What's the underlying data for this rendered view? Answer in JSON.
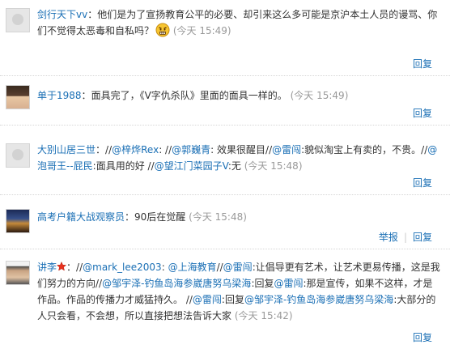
{
  "comments": [
    {
      "avatar": "default-avatar-icon",
      "name": "剑行天下vv",
      "sep": "：",
      "text": "他们是为了宣扬教育公平的必要、却引来这么多可能是京沪本土人员的谩骂、你们不觉得太恶毒和自私吗？",
      "emoji": "angry-emoji-icon",
      "time": "(今天 15:49)",
      "reply": "回复"
    },
    {
      "avatar": "user-photo-avatar",
      "name": "单于1988",
      "sep": "：",
      "text": "面具完了，《V字仇杀队》里面的面具一样的。",
      "time": "(今天 15:49)",
      "reply": "回复"
    },
    {
      "avatar": "default-avatar-icon",
      "name": "大别山居三世",
      "sep": "：",
      "segments": [
        {
          "t": "//",
          "link": false
        },
        {
          "t": "@梓烨Rex",
          "link": true
        },
        {
          "t": ": //",
          "link": false
        },
        {
          "t": "@郭巍青",
          "link": true
        },
        {
          "t": ": 效果很醒目//",
          "link": false
        },
        {
          "t": "@雷闯",
          "link": true
        },
        {
          "t": ":貌似淘宝上有卖的，不贵。//",
          "link": false
        },
        {
          "t": "@泡哥王--屁民",
          "link": true
        },
        {
          "t": ":面具用的好 //",
          "link": false
        },
        {
          "t": "@望江门菜园子V",
          "link": true
        },
        {
          "t": ":无",
          "link": false
        }
      ],
      "time": "(今天 15:48)",
      "reply": "回复"
    },
    {
      "avatar": "user-photo-avatar",
      "name": "高考户籍大战观察员",
      "sep": "：",
      "text": "90后在觉醒",
      "time": "(今天 15:48)",
      "report": "举报",
      "reply": "回复"
    },
    {
      "avatar": "user-photo-avatar",
      "name": "讲李",
      "badge": "star-badge-icon",
      "sep": "：",
      "segments": [
        {
          "t": "//",
          "link": false
        },
        {
          "t": "@mark_lee2003",
          "link": true
        },
        {
          "t": ": ",
          "link": false
        },
        {
          "t": "@上海教育",
          "link": true
        },
        {
          "t": "//",
          "link": false
        },
        {
          "t": "@雷闯",
          "link": true
        },
        {
          "t": ":让倡导更有艺术，让艺术更易传播，这是我们努力的方向//",
          "link": false
        },
        {
          "t": "@邹宇泽-钓鱼岛海参崴唐努乌梁海",
          "link": true
        },
        {
          "t": ":回复",
          "link": false
        },
        {
          "t": "@雷闯",
          "link": true
        },
        {
          "t": ":那是宣传，如果不这样，才是作品。作品的传播力才威猛持久。 //",
          "link": false
        },
        {
          "t": "@雷闯",
          "link": true
        },
        {
          "t": ":回复",
          "link": false
        },
        {
          "t": "@邹宇泽-钓鱼岛海参崴唐努乌梁海",
          "link": true
        },
        {
          "t": ":大部分的人只会看，不会想，所以直接把想法告诉大家",
          "link": false
        }
      ],
      "time": "(今天 15:42)",
      "reply": "回复"
    }
  ]
}
